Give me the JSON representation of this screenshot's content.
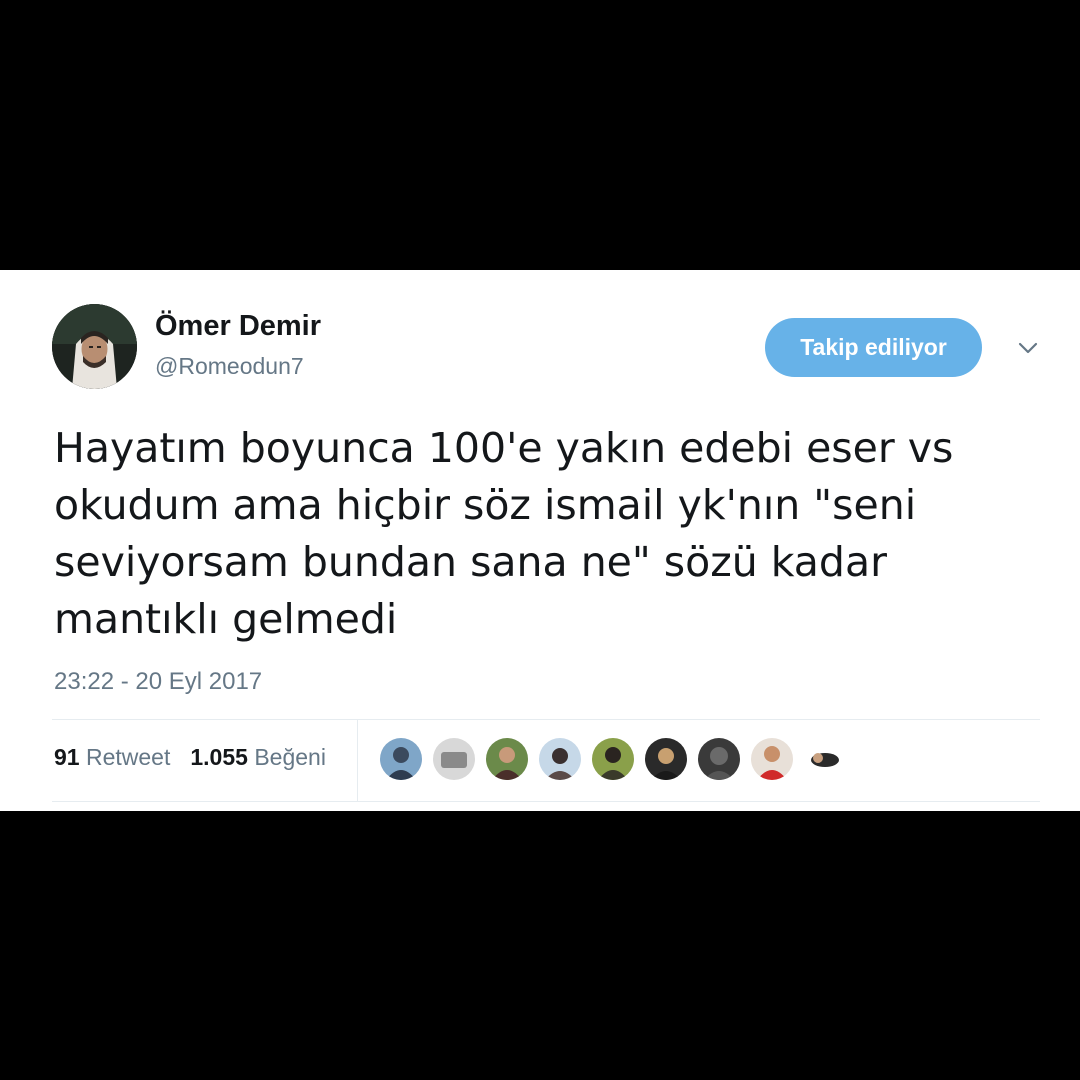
{
  "tweet": {
    "author": {
      "name": "Ömer Demir",
      "handle": "@Romeodun7"
    },
    "follow_button_label": "Takip ediliyor",
    "text": "Hayatım boyunca 100'e yakın edebi eser vs okudum ama hiçbir söz ismail yk'nın \"seni seviyorsam bundan sana ne\" sözü kadar mantıklı gelmedi",
    "timestamp": "23:22 - 20 Eyl 2017",
    "stats": {
      "retweet_count": "91",
      "retweet_label": "Retweet",
      "like_count": "1.055",
      "like_label": "Beğeni"
    },
    "liker_count_shown": 9
  },
  "colors": {
    "follow_button": "#67b2e8",
    "secondary_text": "#657786",
    "primary_text": "#14171a",
    "divider": "#e6ecf0",
    "frame": "#000000"
  },
  "icons": {
    "more": "chevron-down-icon"
  }
}
